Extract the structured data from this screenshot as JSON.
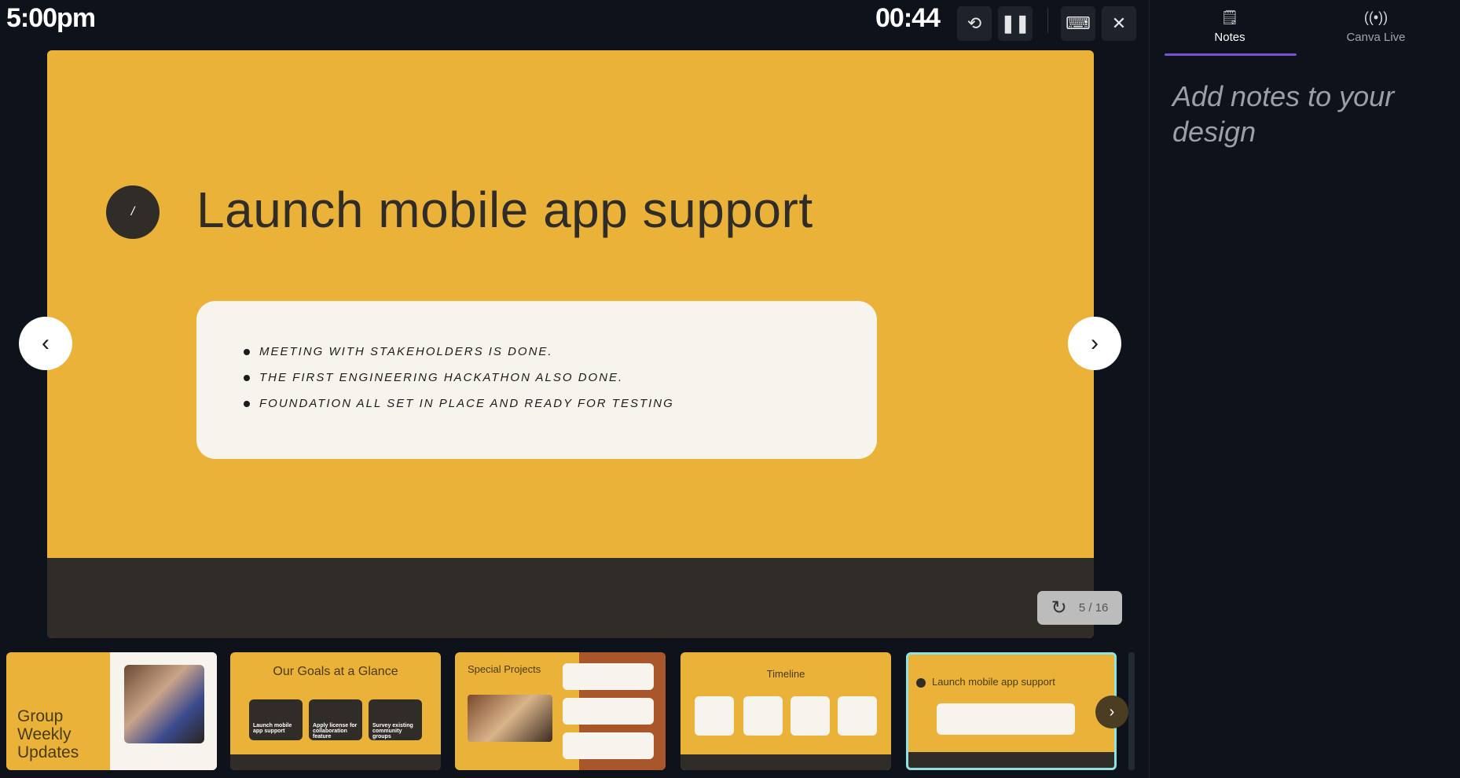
{
  "header": {
    "clock": "5:00pm",
    "timer": "00:44",
    "buttons": {
      "history": "history-icon",
      "pause": "pause-icon",
      "keyboard": "keyboard-icon",
      "close": "close-icon"
    }
  },
  "panel": {
    "tabs": [
      {
        "label": "Notes",
        "icon": "notes-icon",
        "active": true
      },
      {
        "label": "Canva Live",
        "icon": "broadcast-icon",
        "active": false
      }
    ],
    "notes_placeholder": "Add notes to your design"
  },
  "slide": {
    "number": "/",
    "title": "Launch mobile app support",
    "bullets": [
      "Meeting with stakeholders is done.",
      "The first engineering hackathon also done.",
      "Foundation all set in place and ready for testing"
    ],
    "colors": {
      "background": "#ebb23a",
      "dark": "#302c27"
    }
  },
  "counter": {
    "current": 5,
    "total": 16,
    "text": "5 / 16"
  },
  "thumbnails": [
    {
      "title": "Group Weekly Updates"
    },
    {
      "title": "Our Goals at a Glance",
      "items": [
        "Launch mobile app support",
        "Apply license for collaboration feature",
        "Survey existing community groups"
      ]
    },
    {
      "title": "Special Projects"
    },
    {
      "title": "Timeline"
    },
    {
      "title": "Launch mobile app support",
      "selected": true
    }
  ]
}
